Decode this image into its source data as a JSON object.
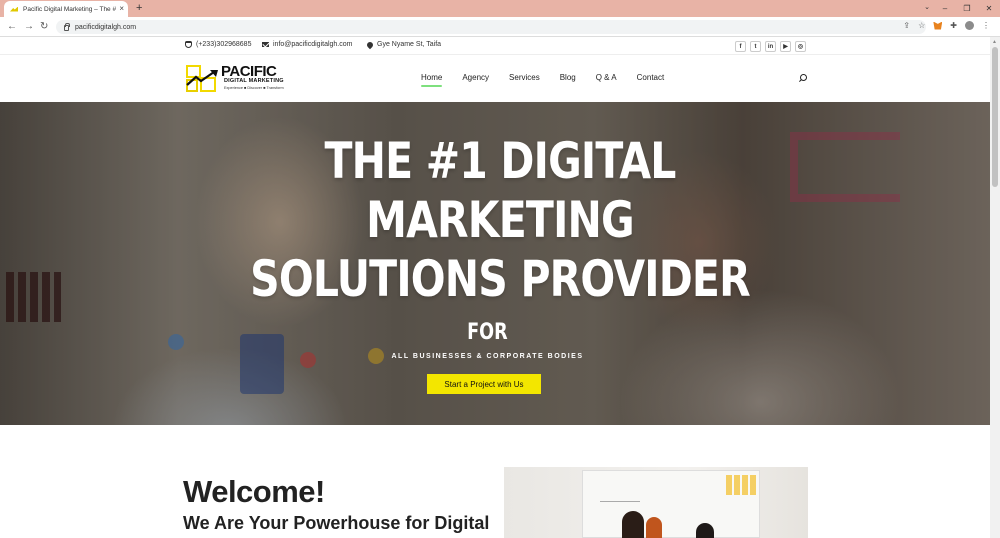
{
  "browser": {
    "tab_title": "Pacific Digital Marketing – The #",
    "url": "pacificdigitalgh.com",
    "new_tab_symbol": "+",
    "close_symbol": "×"
  },
  "topbar": {
    "phone": "(+233)302968685",
    "email": "info@pacificdigitalgh.com",
    "address": "Gye Nyame St, Taifa",
    "socials": [
      "f",
      "t",
      "in",
      "▶",
      "◎"
    ]
  },
  "logo": {
    "name": "PACIFIC",
    "sub": "DIGITAL MARKETING",
    "tagline": "Experience ■ Discover ■ Transform"
  },
  "nav": {
    "items": [
      "Home",
      "Agency",
      "Services",
      "Blog",
      "Q & A",
      "Contact"
    ],
    "active": "Home"
  },
  "hero": {
    "title_line1": "THE #1 DIGITAL",
    "title_line2": "MARKETING",
    "title_line3": "SOLUTIONS PROVIDER",
    "for": "FOR",
    "subtitle": "ALL BUSINESSES & CORPORATE BODIES",
    "cta": "Start a Project with Us"
  },
  "welcome": {
    "heading": "Welcome!",
    "subheading": "We Are Your Powerhouse for Digital"
  },
  "colors": {
    "accent_yellow": "#f3e600",
    "nav_underline": "#7ee07e",
    "tabbar": "#e8b3a6"
  }
}
